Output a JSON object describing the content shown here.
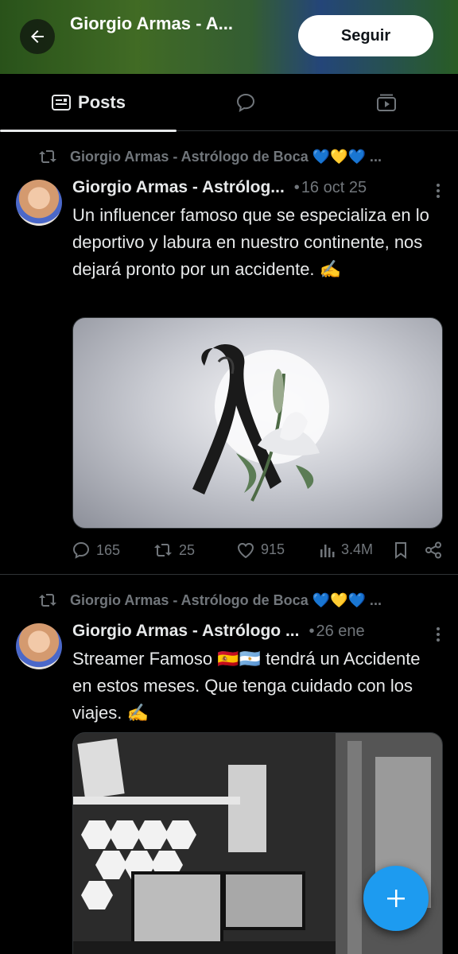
{
  "header": {
    "title": "Giorgio Armas - A...",
    "follow_label": "Seguir"
  },
  "tabs": {
    "posts_label": "Posts"
  },
  "posts": [
    {
      "repost_label": "Giorgio Armas - Astrólogo de Boca 💙💛💙 ...",
      "author": "Giorgio Armas - Astrólog...",
      "dot": "•",
      "date": "16 oct 25",
      "text": "Un influencer famoso que se especializa en lo deportivo y labura en nuestro continente, nos dejará pronto por un accidente. ✍️",
      "replies": "165",
      "reposts": "25",
      "likes": "915",
      "views": "3.4M"
    },
    {
      "repost_label": "Giorgio Armas - Astrólogo de Boca 💙💛💙 ...",
      "author": "Giorgio Armas - Astrólogo ...",
      "dot": "•",
      "date": "26 ene",
      "text": "Streamer Famoso 🇪🇸🇦🇷 tendrá un Accidente en estos meses. Que tenga cuidado con los viajes. ✍️"
    }
  ],
  "colors": {
    "accent": "#1d9bf0",
    "muted": "#71767b",
    "text": "#e7e9ea",
    "background": "#000000"
  },
  "icons": [
    "back-arrow-icon",
    "posts-tab-icon",
    "replies-tab-icon",
    "media-tab-icon",
    "repost-icon",
    "more-icon",
    "reply-icon",
    "like-icon",
    "views-icon",
    "bookmark-icon",
    "share-icon",
    "compose-plus-icon"
  ]
}
